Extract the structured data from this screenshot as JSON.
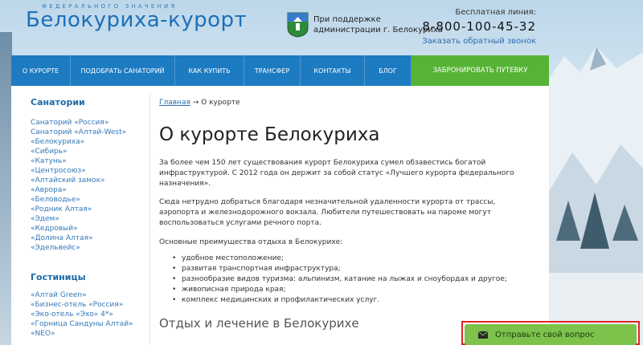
{
  "header": {
    "logo_super": "ФЕДЕРАЛЬНОГО ЗНАЧЕНИЯ",
    "logo_title": "Белокуриха-курорт",
    "support_line1": "При поддержке",
    "support_line2": "администрации г. Белокуриха",
    "phone_caption": "Бесплатная линия:",
    "phone_number": "8-800-100-45-32",
    "callback_link": "Заказать обратный звонок"
  },
  "nav": {
    "items": [
      "О КУРОРТЕ",
      "ПОДОБРАТЬ САНАТОРИЙ",
      "КАК КУПИТЬ",
      "ТРАНСФЕР",
      "КОНТАКТЫ",
      "БЛОГ"
    ],
    "book": "ЗАБРОНИРОВАТЬ ПУТЕВКУ"
  },
  "sidebar": {
    "sanatoriums_title": "Санатории",
    "sanatoriums": [
      "Санаторий «Россия»",
      "Санаторий «Алтай-West»",
      "«Белокуриха»",
      "«Сибирь»",
      "«Катунь»",
      "«Центросоюз»",
      "«Алтайский замок»",
      "«Аврора»",
      "«Беловодье»",
      "«Родник Алтая»",
      "«Эдем»",
      "«Кедровый»",
      "«Долина Алтая»",
      "«Эдельвейс»"
    ],
    "hotels_title": "Гостиницы",
    "hotels": [
      "«Алтай Green»",
      "«Бизнес-отель «Россия»",
      "«Эко-отель «Эхо» 4*»",
      "«Горница Сандуны Алтай»",
      "«NEO»"
    ]
  },
  "main": {
    "breadcrumb_home": "Главная",
    "breadcrumb_sep": " → ",
    "breadcrumb_current": "О курорте",
    "title": "О курорте Белокуриха",
    "para1": "За более чем 150 лет существования курорт Белокуриха сумел обзавестись богатой инфраструктурой. С 2012 года он держит за собой статус «Лучшего курорта федерального назначения».",
    "para2": "Сюда нетрудно добраться благодаря незначительной удаленности курорта от трассы, аэропорта и железнодорожного вокзала. Любители путешествовать на пароме могут воспользоваться услугами речного порта.",
    "para3": "Основные преимущества отдыха в Белокурихе:",
    "advantages": [
      "удобное местоположение;",
      "развитая транспортная инфраструктура;",
      "разнообразие видов туризма: альпинизм, катание на лыжах и сноубордах и другое;",
      "живописная природа края;",
      "комплекс медицинских и профилактических услуг."
    ],
    "subtitle": "Отдых и лечение в Белокурихе"
  },
  "feedback": {
    "label": "Отправьте свой вопрос",
    "icon": "envelope-icon"
  }
}
